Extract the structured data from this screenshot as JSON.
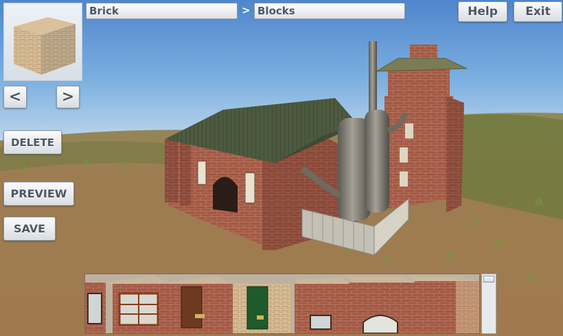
{
  "breadcrumb": {
    "category": "Brick",
    "separator": ">",
    "subcategory": "Blocks"
  },
  "buttons": {
    "help": "Help",
    "exit": "Exit",
    "prev": "<",
    "next": ">",
    "delete": "DELETE",
    "preview": "PREVIEW",
    "save": "SAVE"
  },
  "tray": {
    "items": [
      "window-wall-block",
      "double-window-wall-block",
      "wooden-door-block",
      "green-door-block",
      "small-window-wall-block",
      "arched-window-wall-block",
      "plain-wall-block"
    ]
  },
  "colors": {
    "sky": "#5b90d2",
    "ground": "#9a7a52",
    "brick": "#a85a45",
    "roof": "#4c5a3e",
    "button_text": "#4d5866"
  }
}
